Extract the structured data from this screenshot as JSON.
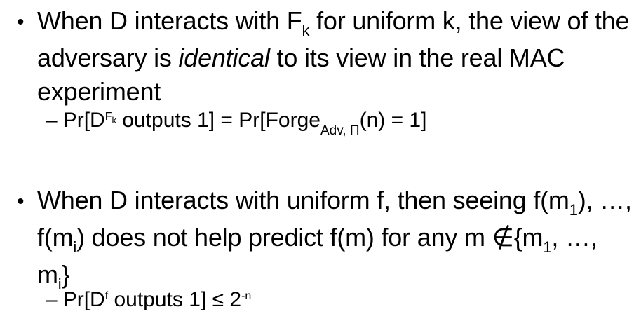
{
  "bullets": [
    {
      "bullet_symbol": "•",
      "main": {
        "a": "When D interacts with F",
        "a_sub": "k",
        "b": " for uniform k, the view of the adversary is ",
        "emph": "identical",
        "c": " to its view in the real MAC experiment"
      },
      "sub": {
        "dash": "–",
        "pre": "Pr[D",
        "sup": "F",
        "sup_sub": "k",
        "mid": " outputs 1] = Pr[Forge",
        "sub": "Adv, Π",
        "post": "(n) = 1]"
      }
    },
    {
      "bullet_symbol": "•",
      "main": {
        "a": "When D interacts with uniform f, then seeing f(m",
        "s1": "1",
        "b": "), …, f(m",
        "s2": "i",
        "c": ") does not help predict f(m) for any m ∉{m",
        "s3": "1",
        "d": ", …, m",
        "s4": "i",
        "e": "}"
      },
      "sub": {
        "dash": "–",
        "pre": "Pr[D",
        "sup": "f",
        "mid": " outputs 1] ≤ 2",
        "exp": "-n"
      }
    }
  ]
}
